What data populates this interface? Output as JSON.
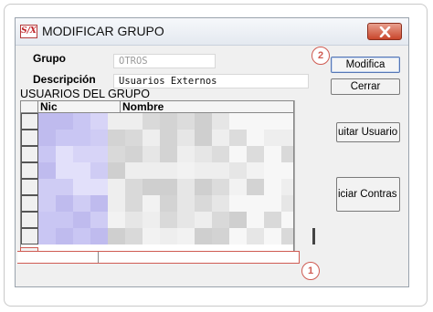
{
  "dialog": {
    "title": "MODIFICAR GRUPO",
    "app_icon_text": "S/X"
  },
  "form": {
    "grupo_label": "Grupo",
    "grupo_value": "OTROS",
    "descripcion_label": "Descripción",
    "descripcion_value": "Usuarios Externos"
  },
  "buttons": {
    "modifica": "Modifica",
    "cerrar": "Cerrar",
    "quitar_usuario": "uitar Usuario",
    "iniciar_contrasena": "iciar Contras"
  },
  "grid": {
    "title": "USUARIOS DEL GRUPO",
    "columns": [
      "Nic",
      "Nombre"
    ],
    "rows_visible": 8
  },
  "annotations": {
    "badge_1": "1",
    "badge_2": "2",
    "color": "#cf5b52"
  }
}
